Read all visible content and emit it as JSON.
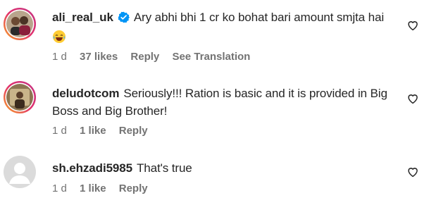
{
  "comments": [
    {
      "username": "ali_real_uk",
      "verified": true,
      "text": "Ary abhi bhi 1 cr ko bohat bari amount smjta hai",
      "emoji": "laughing-tears-emoji",
      "age": "1 d",
      "likes": "37 likes",
      "reply": "Reply",
      "translate": "See Translation"
    },
    {
      "username": "deludotcom",
      "verified": false,
      "text": "Seriously!!! Ration is basic and it is provided in Big Boss and Big Brother!",
      "age": "1 d",
      "likes": "1 like",
      "reply": "Reply"
    },
    {
      "username": "sh.ehzadi5985",
      "verified": false,
      "text": "That's true",
      "age": "1 d",
      "likes": "1 like",
      "reply": "Reply"
    }
  ],
  "colors": {
    "verified_badge": "#0095f6",
    "meta_text": "#737373",
    "text": "#262626"
  }
}
